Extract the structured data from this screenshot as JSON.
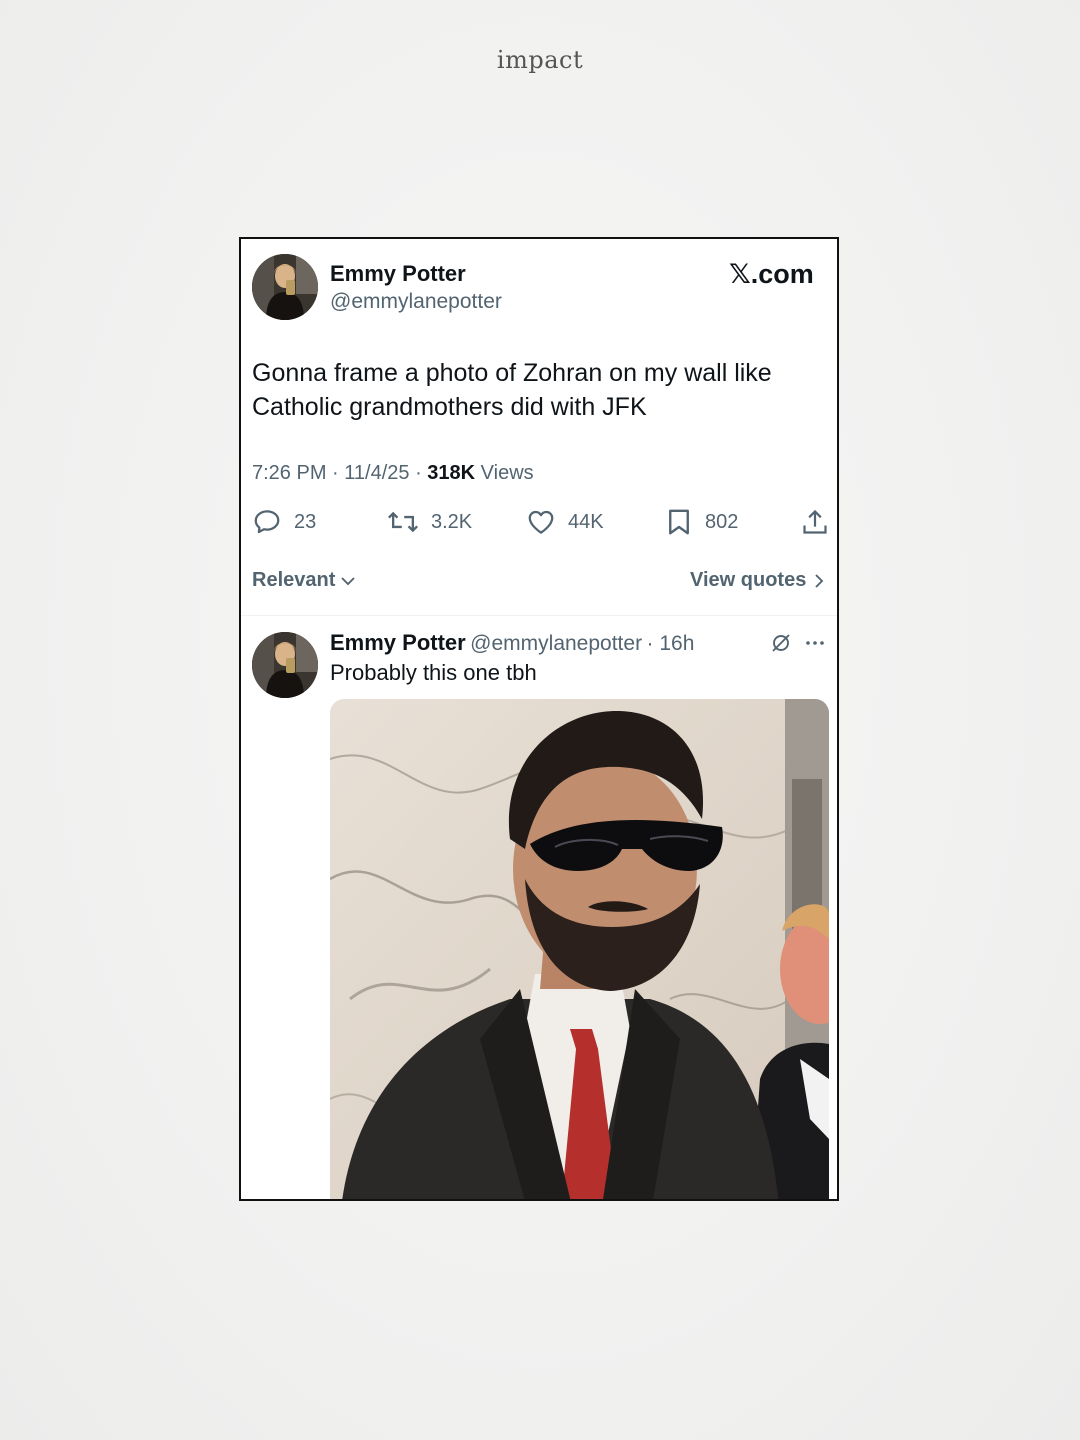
{
  "brand": "impact",
  "tweet": {
    "author_name": "Emmy Potter",
    "author_handle": "@emmylanepotter",
    "source_label": "𝕏.com",
    "text": "Gonna frame a photo of Zohran on my wall like Catholic grandmothers did with JFK",
    "time": "7:26 PM",
    "date": "11/4/25",
    "views_count": "318K",
    "views_label": "Views",
    "stats": {
      "replies": "23",
      "reposts": "3.2K",
      "likes": "44K",
      "bookmarks": "802"
    }
  },
  "sort": {
    "label": "Relevant",
    "quotes_label": "View quotes"
  },
  "reply": {
    "author_name": "Emmy Potter",
    "author_handle": "@emmylanepotter",
    "age": "16h",
    "text": "Probably this one tbh"
  },
  "icons": {
    "reply": "speech-bubble-icon",
    "repost": "repost-arrows-icon",
    "like": "heart-icon",
    "bookmark": "bookmark-icon",
    "share": "share-upload-icon",
    "sort_chevron": "chevron-down-icon",
    "quotes_chevron": "chevron-right-icon",
    "grok": "grok-icon",
    "more": "more-dots-icon"
  }
}
